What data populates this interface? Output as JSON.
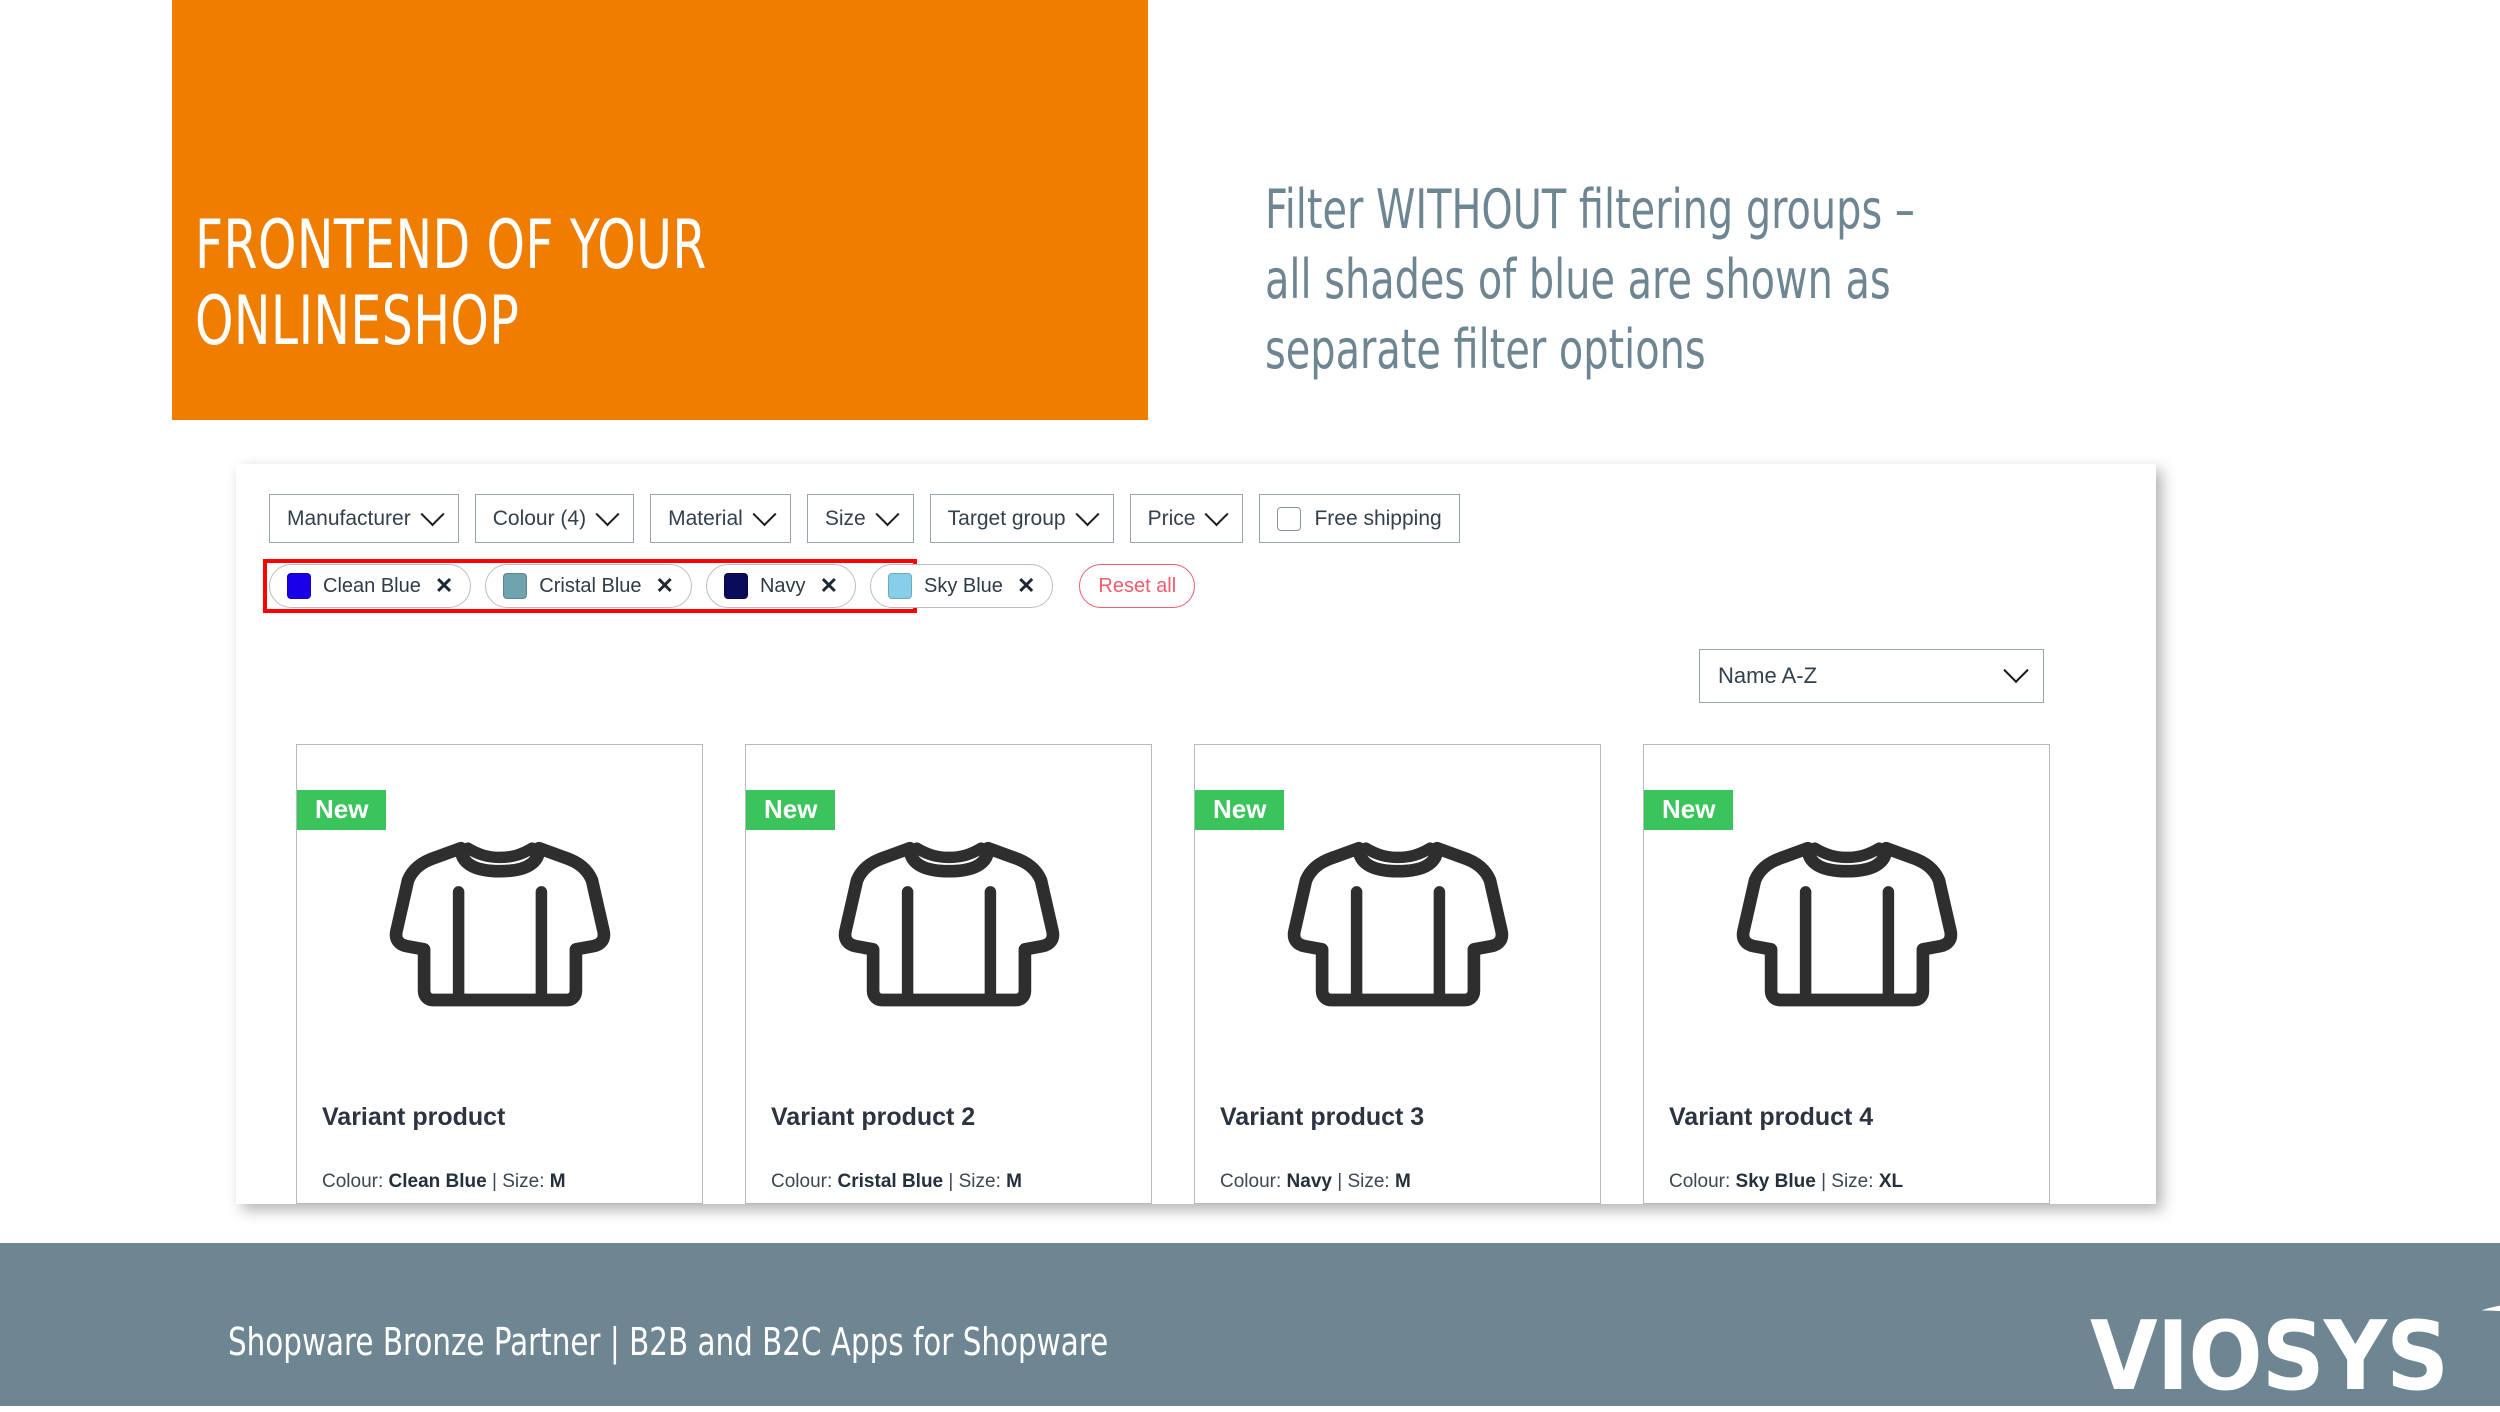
{
  "slide": {
    "title": "FRONTEND OF YOUR\nONLINESHOP",
    "subtitle": "Filter WITHOUT filtering groups –\nall shades of blue are shown as\nseparate filter options",
    "accent_orange": "#EF7D00",
    "accent_slate": "#6E8692"
  },
  "shop": {
    "filters": [
      {
        "label": "Manufacturer",
        "type": "dropdown"
      },
      {
        "label": "Colour  (4)",
        "type": "dropdown"
      },
      {
        "label": "Material",
        "type": "dropdown"
      },
      {
        "label": "Size",
        "type": "dropdown"
      },
      {
        "label": "Target group",
        "type": "dropdown"
      },
      {
        "label": "Price",
        "type": "dropdown"
      },
      {
        "label": "Free shipping",
        "type": "checkbox",
        "checked": false
      }
    ],
    "active_tags": [
      {
        "label": "Clean Blue",
        "swatch": "#1A00E8",
        "remove": "✕"
      },
      {
        "label": "Cristal Blue",
        "swatch": "#6FA3AE",
        "remove": "✕"
      },
      {
        "label": "Navy",
        "swatch": "#0B0B5C",
        "remove": "✕"
      },
      {
        "label": "Sky Blue",
        "swatch": "#87CEEB",
        "remove": "✕"
      }
    ],
    "reset_label": "Reset all",
    "reset_color": "#F05B6E",
    "highlight_color": "#FF0000",
    "sort": {
      "value": "Name A-Z"
    },
    "badge_label": "New",
    "badge_color": "#3BC45C",
    "products": [
      {
        "title": "Variant product",
        "meta_prefix": "Colour: ",
        "colour": "Clean Blue",
        "size_prefix": " | Size: ",
        "size": "M"
      },
      {
        "title": "Variant product 2",
        "meta_prefix": "Colour: ",
        "colour": "Cristal Blue",
        "size_prefix": " | Size: ",
        "size": "M"
      },
      {
        "title": "Variant product 3",
        "meta_prefix": "Colour: ",
        "colour": "Navy",
        "size_prefix": " | Size: ",
        "size": "M"
      },
      {
        "title": "Variant product 4",
        "meta_prefix": "Colour: ",
        "colour": "Sky Blue",
        "size_prefix": " | Size: ",
        "size": "XL"
      }
    ]
  },
  "footer": {
    "text": "Shopware Bronze Partner  |  B2B and B2C Apps for Shopware",
    "logo_word": "VIOSYS"
  }
}
